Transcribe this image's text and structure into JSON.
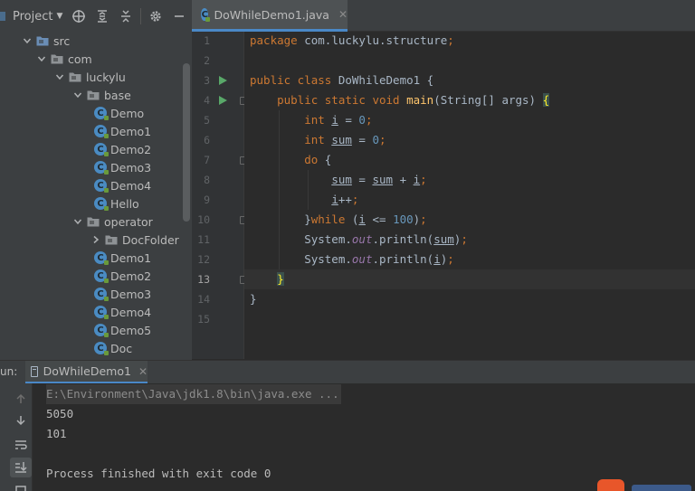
{
  "project": {
    "title": "Project",
    "tree": [
      {
        "label": "src",
        "depth": 0,
        "kind": "folder-src",
        "expanded": true
      },
      {
        "label": "com",
        "depth": 1,
        "kind": "package",
        "expanded": true
      },
      {
        "label": "luckylu",
        "depth": 2,
        "kind": "package",
        "expanded": true
      },
      {
        "label": "base",
        "depth": 3,
        "kind": "package",
        "expanded": true
      },
      {
        "label": "Demo",
        "depth": 4,
        "kind": "class"
      },
      {
        "label": "Demo1",
        "depth": 4,
        "kind": "class"
      },
      {
        "label": "Demo2",
        "depth": 4,
        "kind": "class"
      },
      {
        "label": "Demo3",
        "depth": 4,
        "kind": "class"
      },
      {
        "label": "Demo4",
        "depth": 4,
        "kind": "class"
      },
      {
        "label": "Hello",
        "depth": 4,
        "kind": "class"
      },
      {
        "label": "operator",
        "depth": 3,
        "kind": "package",
        "expanded": true
      },
      {
        "label": "DocFolder",
        "depth": 4,
        "kind": "package",
        "expanded": false
      },
      {
        "label": "Demo1",
        "depth": 4,
        "kind": "class"
      },
      {
        "label": "Demo2",
        "depth": 4,
        "kind": "class"
      },
      {
        "label": "Demo3",
        "depth": 4,
        "kind": "class"
      },
      {
        "label": "Demo4",
        "depth": 4,
        "kind": "class"
      },
      {
        "label": "Demo5",
        "depth": 4,
        "kind": "class"
      },
      {
        "label": "Doc",
        "depth": 4,
        "kind": "class"
      }
    ]
  },
  "editor": {
    "tab": {
      "label": "DoWhileDemo1.java",
      "close": "✕"
    },
    "current_line": 13,
    "run_gutter_lines": [
      3,
      4
    ],
    "fold_lines": [
      4,
      7,
      10,
      13
    ],
    "lines": [
      {
        "n": "1",
        "tokens": [
          {
            "t": "package ",
            "c": "kw"
          },
          {
            "t": "com.luckylu.structure",
            "c": ""
          },
          {
            "t": ";",
            "c": "kw"
          }
        ]
      },
      {
        "n": "2",
        "tokens": []
      },
      {
        "n": "3",
        "tokens": [
          {
            "t": "public class ",
            "c": "kw"
          },
          {
            "t": "DoWhileDemo1 {",
            "c": ""
          }
        ]
      },
      {
        "n": "4",
        "tokens": [
          {
            "t": "    public static void ",
            "c": "kw"
          },
          {
            "t": "main",
            "c": "fn"
          },
          {
            "t": "(String[] args) ",
            "c": ""
          },
          {
            "t": "{",
            "c": "brace-hl"
          }
        ]
      },
      {
        "n": "5",
        "tokens": [
          {
            "t": "        int ",
            "c": "kw"
          },
          {
            "t": "i",
            "c": "var"
          },
          {
            "t": " = ",
            "c": ""
          },
          {
            "t": "0",
            "c": "num"
          },
          {
            "t": ";",
            "c": "kw"
          }
        ]
      },
      {
        "n": "6",
        "tokens": [
          {
            "t": "        int ",
            "c": "kw"
          },
          {
            "t": "sum",
            "c": "var"
          },
          {
            "t": " = ",
            "c": ""
          },
          {
            "t": "0",
            "c": "num"
          },
          {
            "t": ";",
            "c": "kw"
          }
        ]
      },
      {
        "n": "7",
        "tokens": [
          {
            "t": "        do ",
            "c": "kw"
          },
          {
            "t": "{",
            "c": ""
          }
        ]
      },
      {
        "n": "8",
        "tokens": [
          {
            "t": "            ",
            "c": ""
          },
          {
            "t": "sum",
            "c": "var"
          },
          {
            "t": " = ",
            "c": ""
          },
          {
            "t": "sum",
            "c": "var"
          },
          {
            "t": " + ",
            "c": ""
          },
          {
            "t": "i",
            "c": "var"
          },
          {
            "t": ";",
            "c": "kw"
          }
        ]
      },
      {
        "n": "9",
        "tokens": [
          {
            "t": "            ",
            "c": ""
          },
          {
            "t": "i",
            "c": "var"
          },
          {
            "t": "++",
            "c": ""
          },
          {
            "t": ";",
            "c": "kw"
          }
        ]
      },
      {
        "n": "10",
        "tokens": [
          {
            "t": "        }",
            "c": ""
          },
          {
            "t": "while ",
            "c": "kw"
          },
          {
            "t": "(",
            "c": ""
          },
          {
            "t": "i",
            "c": "var"
          },
          {
            "t": " <= ",
            "c": ""
          },
          {
            "t": "100",
            "c": "num"
          },
          {
            "t": ")",
            "c": ""
          },
          {
            "t": ";",
            "c": "kw"
          }
        ]
      },
      {
        "n": "11",
        "tokens": [
          {
            "t": "        System.",
            "c": ""
          },
          {
            "t": "out",
            "c": "fld"
          },
          {
            "t": ".println(",
            "c": ""
          },
          {
            "t": "sum",
            "c": "var"
          },
          {
            "t": ")",
            "c": ""
          },
          {
            "t": ";",
            "c": "kw"
          }
        ]
      },
      {
        "n": "12",
        "tokens": [
          {
            "t": "        System.",
            "c": ""
          },
          {
            "t": "out",
            "c": "fld"
          },
          {
            "t": ".println(",
            "c": ""
          },
          {
            "t": "i",
            "c": "var"
          },
          {
            "t": ")",
            "c": ""
          },
          {
            "t": ";",
            "c": "kw"
          }
        ]
      },
      {
        "n": "13",
        "tokens": [
          {
            "t": "    ",
            "c": ""
          },
          {
            "t": "}",
            "c": "brace-hl"
          }
        ]
      },
      {
        "n": "14",
        "tokens": [
          {
            "t": "}",
            "c": ""
          }
        ]
      },
      {
        "n": "15",
        "tokens": []
      }
    ]
  },
  "run": {
    "label": "un:",
    "tab": {
      "label": "DoWhileDemo1",
      "close": "✕"
    },
    "output": [
      {
        "text": "E:\\Environment\\Java\\jdk1.8\\bin\\java.exe ...",
        "kind": "cmd"
      },
      {
        "text": "5050",
        "kind": "out"
      },
      {
        "text": "101",
        "kind": "out"
      },
      {
        "text": "",
        "kind": "out"
      },
      {
        "text": "Process finished with exit code 0",
        "kind": "out"
      }
    ]
  },
  "colors": {
    "keyword": "#cc7832",
    "method": "#ffc66d",
    "number": "#6897bb",
    "field": "#9876aa",
    "text": "#a9b7c6",
    "run_green": "#59a869",
    "accent_blue": "#4a88c7"
  }
}
